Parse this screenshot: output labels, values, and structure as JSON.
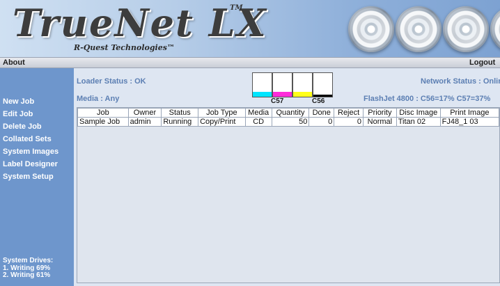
{
  "header": {
    "title": "TrueNet LX",
    "trademark": "TM",
    "subtitle": "R-Quest Technologies™"
  },
  "topbar": {
    "about_label": "About",
    "logout_label": "Logout"
  },
  "sidebar": {
    "items": [
      {
        "label": "New Job"
      },
      {
        "label": "Edit Job"
      },
      {
        "label": "Delete Job"
      },
      {
        "label": "Collated Sets"
      },
      {
        "label": "System Images"
      },
      {
        "label": "Label Designer"
      },
      {
        "label": "System Setup"
      }
    ],
    "drives_title": "System Drives:",
    "drives": [
      {
        "label": "1. Writing 69%"
      },
      {
        "label": "2. Writing 61%"
      }
    ]
  },
  "status": {
    "loader": "Loader Status : OK",
    "media": "Media : Any",
    "network": "Network Status : Online",
    "flashjet": "FlashJet 4800 : C56=17% C57=37%"
  },
  "ink": {
    "cartridges": [
      {
        "name": "cyan",
        "color": "#00e5ff",
        "level": 0.2
      },
      {
        "name": "magenta",
        "color": "#ff2bd9",
        "level": 0.2
      },
      {
        "name": "yellow",
        "color": "#ffff1a",
        "level": 0.2
      },
      {
        "name": "black",
        "color": "#000000",
        "level": 0.1
      }
    ],
    "label_c57": "C57",
    "label_c56": "C56"
  },
  "job_table": {
    "columns": [
      "Job",
      "Owner",
      "Status",
      "Job Type",
      "Media",
      "Quantity",
      "Done",
      "Reject",
      "Priority",
      "Disc Image",
      "Print Image"
    ],
    "rows": [
      [
        "Sample Job",
        "admin",
        "Running",
        "Copy/Print",
        "CD",
        "50",
        "0",
        "0",
        "Normal",
        "Titan 02",
        "FJ48_1 03"
      ]
    ]
  },
  "colors": {
    "sidebar_bg": "#6e96cc",
    "status_text": "#5c7fb3",
    "main_bg": "#dee6f2"
  }
}
